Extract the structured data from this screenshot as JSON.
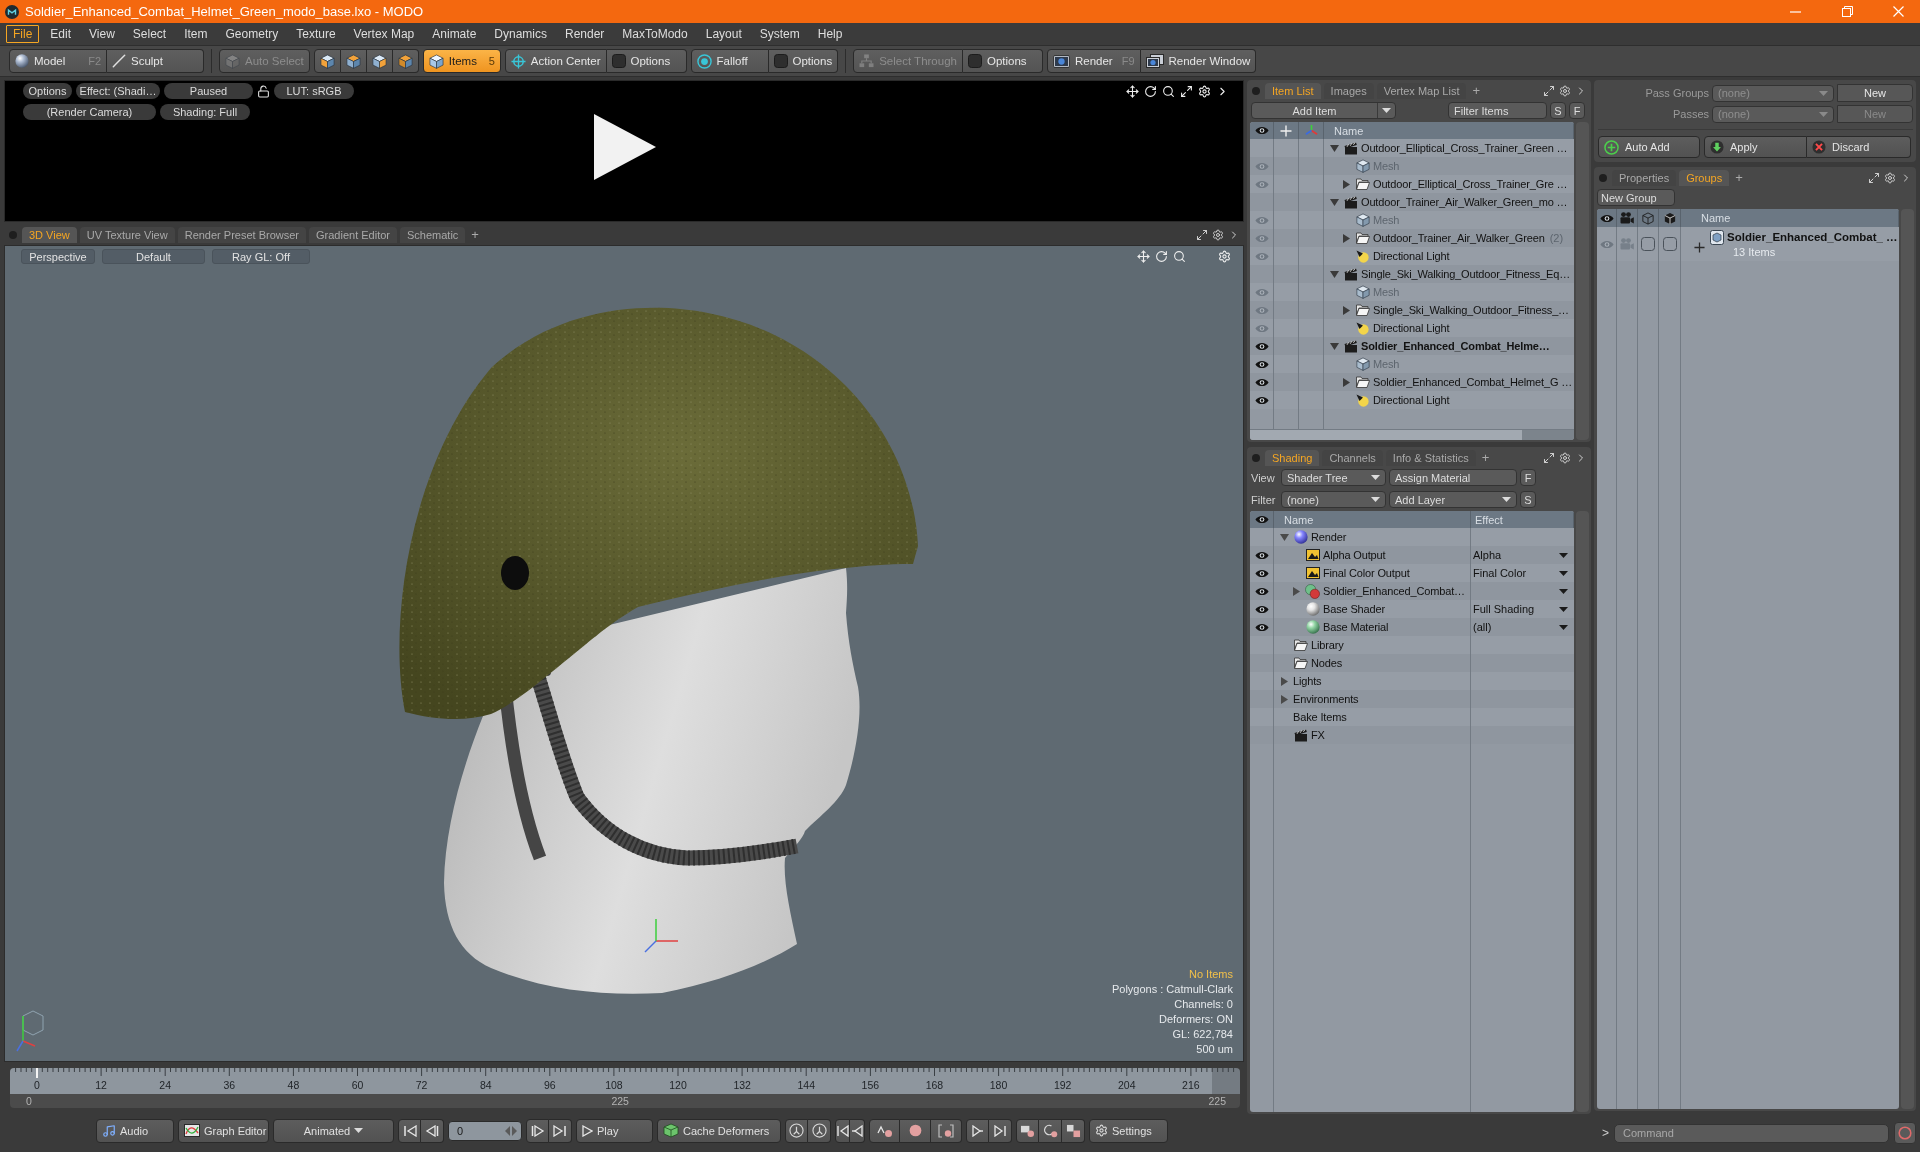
{
  "window": {
    "title": "Soldier_Enhanced_Combat_Helmet_Green_modo_base.lxo - MODO"
  },
  "menu": [
    {
      "label": "File",
      "selected": true
    },
    {
      "label": "Edit",
      "selected": false
    },
    {
      "label": "View",
      "selected": false
    },
    {
      "label": "Select",
      "selected": false
    },
    {
      "label": "Item",
      "selected": false
    },
    {
      "label": "Geometry",
      "selected": false
    },
    {
      "label": "Texture",
      "selected": false
    },
    {
      "label": "Vertex Map",
      "selected": false
    },
    {
      "label": "Animate",
      "selected": false
    },
    {
      "label": "Dynamics",
      "selected": false
    },
    {
      "label": "Render",
      "selected": false
    },
    {
      "label": "MaxToModo",
      "selected": false
    },
    {
      "label": "Layout",
      "selected": false
    },
    {
      "label": "System",
      "selected": false
    },
    {
      "label": "Help",
      "selected": false
    }
  ],
  "toolbar": [
    {
      "buttons": [
        {
          "kind": "model",
          "label": "Model",
          "shortcut": "F2",
          "selected": false,
          "disabled": false
        },
        {
          "kind": "sculpt",
          "label": "Sculpt",
          "selected": false,
          "disabled": false
        }
      ]
    },
    {
      "buttons": [
        {
          "kind": "auto_select",
          "label": "Auto Select",
          "selected": false,
          "disabled": true
        }
      ]
    },
    {
      "buttons": [
        {
          "kind": "vertices",
          "selected": false,
          "disabled": false
        },
        {
          "kind": "edges",
          "selected": false,
          "disabled": false
        },
        {
          "kind": "polygons",
          "selected": false,
          "disabled": false
        },
        {
          "kind": "materials",
          "selected": false,
          "disabled": false
        }
      ]
    },
    {
      "buttons": [
        {
          "kind": "items",
          "label": "Items",
          "shortcut": "5",
          "selected": true,
          "disabled": false
        }
      ]
    },
    {
      "buttons": [
        {
          "kind": "action_center",
          "label": "Action Center",
          "selected": false,
          "disabled": false
        },
        {
          "kind": "options",
          "label": "Options",
          "selected": false,
          "disabled": false
        }
      ]
    },
    {
      "buttons": [
        {
          "kind": "falloff",
          "label": "Falloff",
          "selected": false,
          "disabled": false
        },
        {
          "kind": "options",
          "label": "Options",
          "selected": false,
          "disabled": false
        }
      ]
    },
    {
      "buttons": [
        {
          "kind": "select_through",
          "label": "Select Through",
          "selected": false,
          "disabled": true
        },
        {
          "kind": "options",
          "label": "Options",
          "selected": false,
          "disabled": false
        }
      ]
    },
    {
      "buttons": [
        {
          "kind": "render",
          "label": "Render",
          "shortcut": "F9",
          "selected": false,
          "disabled": false
        },
        {
          "kind": "render_window",
          "label": "Render Window",
          "selected": false,
          "disabled": false
        }
      ]
    }
  ],
  "render_preview": {
    "buttons_left": [
      "Options",
      "Effect: (Shadi…",
      "Paused"
    ],
    "buttons_right": [
      "LUT: sRGB"
    ],
    "row_2": [
      "(Render Camera)",
      "Shading: Full"
    ]
  },
  "viewport_tabs": {
    "tabs": [
      {
        "label": "3D View",
        "selected": true
      },
      {
        "label": "UV Texture View",
        "selected": false
      },
      {
        "label": "Render Preset Browser",
        "selected": false
      },
      {
        "label": "Gradient Editor",
        "selected": false
      },
      {
        "label": "Schematic",
        "selected": false
      }
    ],
    "add_tab": "+"
  },
  "viewport": {
    "header": [
      "Perspective",
      "Default",
      "Ray GL: Off"
    ],
    "info": [
      {
        "text": "No Items",
        "highlight": true
      },
      {
        "text": "Polygons : Catmull-Clark",
        "highlight": false
      },
      {
        "text": "Channels: 0",
        "highlight": false
      },
      {
        "text": "Deformers: ON",
        "highlight": false
      },
      {
        "text": "GL: 622,784",
        "highlight": false
      },
      {
        "text": "500 um",
        "highlight": false
      }
    ]
  },
  "timeline": {
    "ruler_labels": [
      "0",
      "12",
      "24",
      "36",
      "48",
      "60",
      "72",
      "84",
      "96",
      "108",
      "120",
      "132",
      "144",
      "156",
      "168",
      "180",
      "192",
      "204",
      "216"
    ],
    "range_start": "0",
    "range_middle": "225",
    "range_end": "225"
  },
  "transport": {
    "audio": "Audio",
    "graph_editor": "Graph Editor",
    "mode": "Animated",
    "frame": "0",
    "play": "Play",
    "cache": "Cache Deformers",
    "settings": "Settings"
  },
  "item_list": {
    "tabs": [
      {
        "label": "Item List",
        "selected": true
      },
      {
        "label": "Images",
        "selected": false
      },
      {
        "label": "Vertex Map List",
        "selected": false
      }
    ],
    "add_tab": "+",
    "add_item": "Add Item",
    "filter": "Filter Items",
    "s_button": "S",
    "f_button": "F",
    "name_column": "Name",
    "tree": [
      {
        "kind": "scene",
        "name": "Outdoor_Elliptical_Cross_Trainer_Green …",
        "current": false,
        "expanded": true,
        "children": [
          {
            "kind": "mesh",
            "name": "Mesh",
            "visible": false
          },
          {
            "kind": "group",
            "name": "Outdoor_Elliptical_Cross_Trainer_Gre …",
            "visible": false,
            "expanded": false
          }
        ]
      },
      {
        "kind": "scene",
        "name": "Outdoor_Trainer_Air_Walker_Green_mo …",
        "current": false,
        "expanded": true,
        "children": [
          {
            "kind": "mesh",
            "name": "Mesh",
            "visible": false
          },
          {
            "kind": "group",
            "name": "Outdoor_Trainer_Air_Walker_Green",
            "suffix": "(2)",
            "visible": false,
            "expanded": false
          },
          {
            "kind": "light",
            "name": "Directional Light",
            "visible": false
          }
        ]
      },
      {
        "kind": "scene",
        "name": "Single_Ski_Walking_Outdoor_Fitness_Eq…",
        "current": false,
        "expanded": true,
        "children": [
          {
            "kind": "mesh",
            "name": "Mesh",
            "visible": false
          },
          {
            "kind": "group",
            "name": "Single_Ski_Walking_Outdoor_Fitness_…",
            "visible": false,
            "expanded": false
          },
          {
            "kind": "light",
            "name": "Directional Light",
            "visible": false
          }
        ]
      },
      {
        "kind": "scene",
        "name": "Soldier_Enhanced_Combat_Helme…",
        "current": true,
        "visible": true,
        "expanded": true,
        "children": [
          {
            "kind": "mesh",
            "name": "Mesh",
            "visible": true
          },
          {
            "kind": "group",
            "name": "Soldier_Enhanced_Combat_Helmet_G …",
            "visible": true,
            "expanded": false
          },
          {
            "kind": "light",
            "name": "Directional Light",
            "visible": true
          }
        ]
      }
    ]
  },
  "shading": {
    "tabs": [
      {
        "label": "Shading",
        "selected": true
      },
      {
        "label": "Channels",
        "selected": false
      },
      {
        "label": "Info & Statistics",
        "selected": false
      }
    ],
    "add_tab": "+",
    "view_label": "View",
    "view": "Shader Tree",
    "assign": "Assign Material",
    "f_button": "F",
    "filter_label": "Filter",
    "filter": "(none)",
    "add_layer": "Add Layer",
    "s_button": "S",
    "columns": [
      "Name",
      "Effect"
    ],
    "tree": [
      {
        "kind": "render",
        "name": "Render",
        "expanded": true,
        "children": [
          {
            "kind": "output",
            "name": "Alpha Output",
            "effect": "Alpha",
            "visible": true
          },
          {
            "kind": "output",
            "name": "Final Color Output",
            "effect": "Final Color",
            "visible": true
          },
          {
            "kind": "material_group",
            "name": "Soldier_Enhanced_Combat…",
            "expanded": false,
            "visible": true
          },
          {
            "kind": "shader",
            "name": "Base Shader",
            "effect": "Full Shading",
            "visible": true
          },
          {
            "kind": "material",
            "name": "Base Material",
            "effect": "(all)",
            "visible": true
          }
        ]
      },
      {
        "kind": "folder",
        "name": "Library"
      },
      {
        "kind": "folder",
        "name": "Nodes"
      },
      {
        "kind": "category",
        "name": "Lights",
        "expanded": false
      },
      {
        "kind": "category",
        "name": "Environments",
        "expanded": false
      },
      {
        "kind": "category",
        "name": "Bake Items"
      },
      {
        "kind": "fx",
        "name": "FX"
      }
    ]
  },
  "passes": {
    "rows": [
      {
        "label": "Pass Groups",
        "value": "(none)",
        "button": "New",
        "disabled": false
      },
      {
        "label": "Passes",
        "value": "(none)",
        "button": "New",
        "disabled": true
      }
    ],
    "auto_add": "Auto Add",
    "apply": "Apply",
    "discard": "Discard"
  },
  "groups": {
    "tabs": [
      {
        "label": "Properties",
        "selected": false
      },
      {
        "label": "Groups",
        "selected": true
      }
    ],
    "add_tab": "+",
    "new_group": "New Group",
    "name_column": "Name",
    "rows": [
      {
        "name": "Soldier_Enhanced_Combat_ …",
        "count": "13 Items",
        "expanded": false,
        "visible": false,
        "toggles": [
          {
            "on": false
          },
          {
            "on": false
          }
        ]
      }
    ]
  },
  "command": {
    "prompt": ">",
    "placeholder": "Command"
  }
}
